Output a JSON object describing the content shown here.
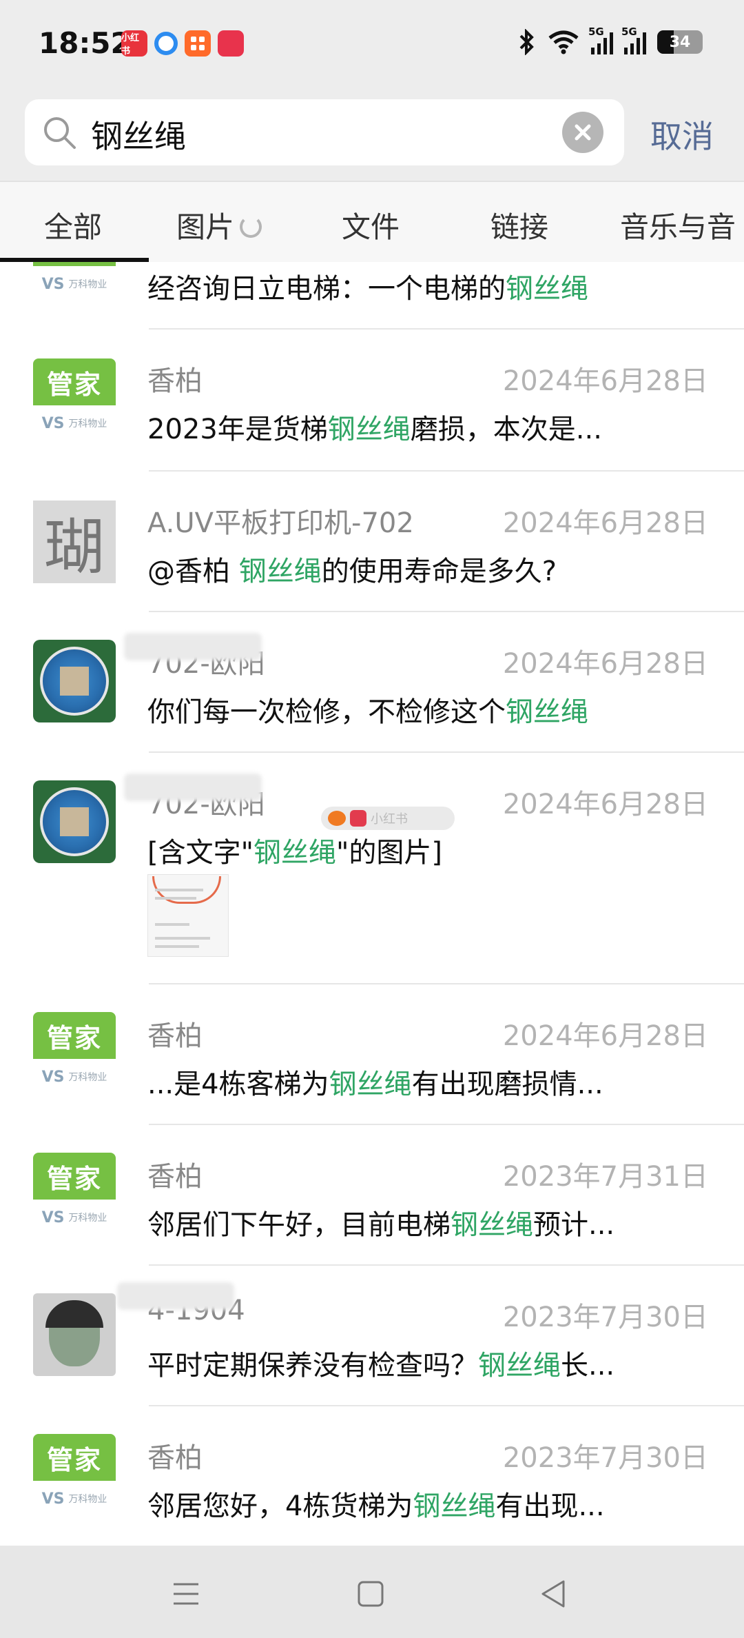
{
  "status_bar": {
    "time": "18:52",
    "app_badges": [
      {
        "name": "xiaohongshu-app-icon",
        "label": "小红书",
        "color": "#e8333c"
      },
      {
        "name": "browser-app-icon",
        "label": "",
        "color": "#2d8cf0"
      },
      {
        "name": "taobao-app-icon",
        "label": "",
        "color": "#ff6a2a"
      },
      {
        "name": "shop-app-icon",
        "label": "",
        "color": "#e8334c"
      }
    ],
    "network_1": "5G",
    "network_2": "5G",
    "battery": "34"
  },
  "search": {
    "query": "钢丝绳",
    "cancel_label": "取消"
  },
  "tabs": [
    "全部",
    "图片",
    "文件",
    "链接",
    "音乐与音"
  ],
  "highlight_color": "#2fa564",
  "results": [
    {
      "avatar": "guanjia",
      "name": "",
      "date": "",
      "msg_pre": "经咨询日立电梯：一个电梯的",
      "msg_hl": "钢丝绳",
      "msg_post": ""
    },
    {
      "avatar": "guanjia",
      "name": "香柏",
      "date": "2024年6月28日",
      "msg_pre": "2023年是货梯",
      "msg_hl": "钢丝绳",
      "msg_post": "磨损，本次是..."
    },
    {
      "avatar": "uv",
      "name": "A.UV平板打印机-702",
      "date": "2024年6月28日",
      "msg_pre": "@香柏 ",
      "msg_hl": "钢丝绳",
      "msg_post": "的使用寿命是多久?"
    },
    {
      "avatar": "badge",
      "name": "702-欧阳",
      "date": "2024年6月28日",
      "msg_pre": "你们每一次检修，不检修这个",
      "msg_hl": "钢丝绳",
      "msg_post": ""
    },
    {
      "avatar": "badge",
      "name": "702-欧阳",
      "date": "2024年6月28日",
      "msg_pre": "[含文字\"",
      "msg_hl": "钢丝绳",
      "msg_post": "\"的图片]"
    },
    {
      "avatar": "guanjia",
      "name": "香柏",
      "date": "2024年6月28日",
      "msg_pre": "...是4栋客梯为",
      "msg_hl": "钢丝绳",
      "msg_post": "有出现磨损情..."
    },
    {
      "avatar": "guanjia",
      "name": "香柏",
      "date": "2023年7月31日",
      "msg_pre": "邻居们下午好，目前电梯",
      "msg_hl": "钢丝绳",
      "msg_post": "预计..."
    },
    {
      "avatar": "photo",
      "name": "4-1904",
      "date": "2023年7月30日",
      "msg_pre": "平时定期保养没有检查吗？",
      "msg_hl": "钢丝绳",
      "msg_post": "长..."
    },
    {
      "avatar": "guanjia",
      "name": "香柏",
      "date": "2023年7月30日",
      "msg_pre": "邻居您好，4栋货梯为",
      "msg_hl": "钢丝绳",
      "msg_post": "有出现..."
    }
  ],
  "avatar_guanjia": {
    "label": "管家",
    "logo_mark": "VS",
    "logo_text": "万科物业"
  },
  "avatar_uv_char": "瑚",
  "watermark": "小红书"
}
